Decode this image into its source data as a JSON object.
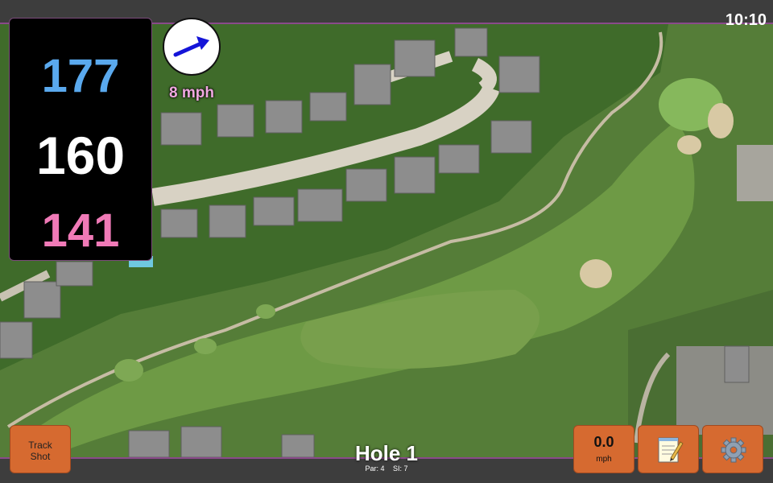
{
  "status": {
    "clock": "10:10"
  },
  "yardage": {
    "back": "177",
    "middle": "160",
    "front": "141"
  },
  "wind": {
    "speed_label": "8 mph",
    "arrow_icon": "wind-direction-arrow",
    "arrow_color": "#1414d8"
  },
  "buttons": {
    "track_shot_line1": "Track",
    "track_shot_line2": "Shot",
    "speed_value": "0.0",
    "speed_unit": "mph",
    "notes_icon": "notepad-icon",
    "settings_icon": "gear-icon",
    "accent": "#d66a30"
  },
  "hole": {
    "title": "Hole 1",
    "par": "Par: 4",
    "si": "SI: 7"
  }
}
